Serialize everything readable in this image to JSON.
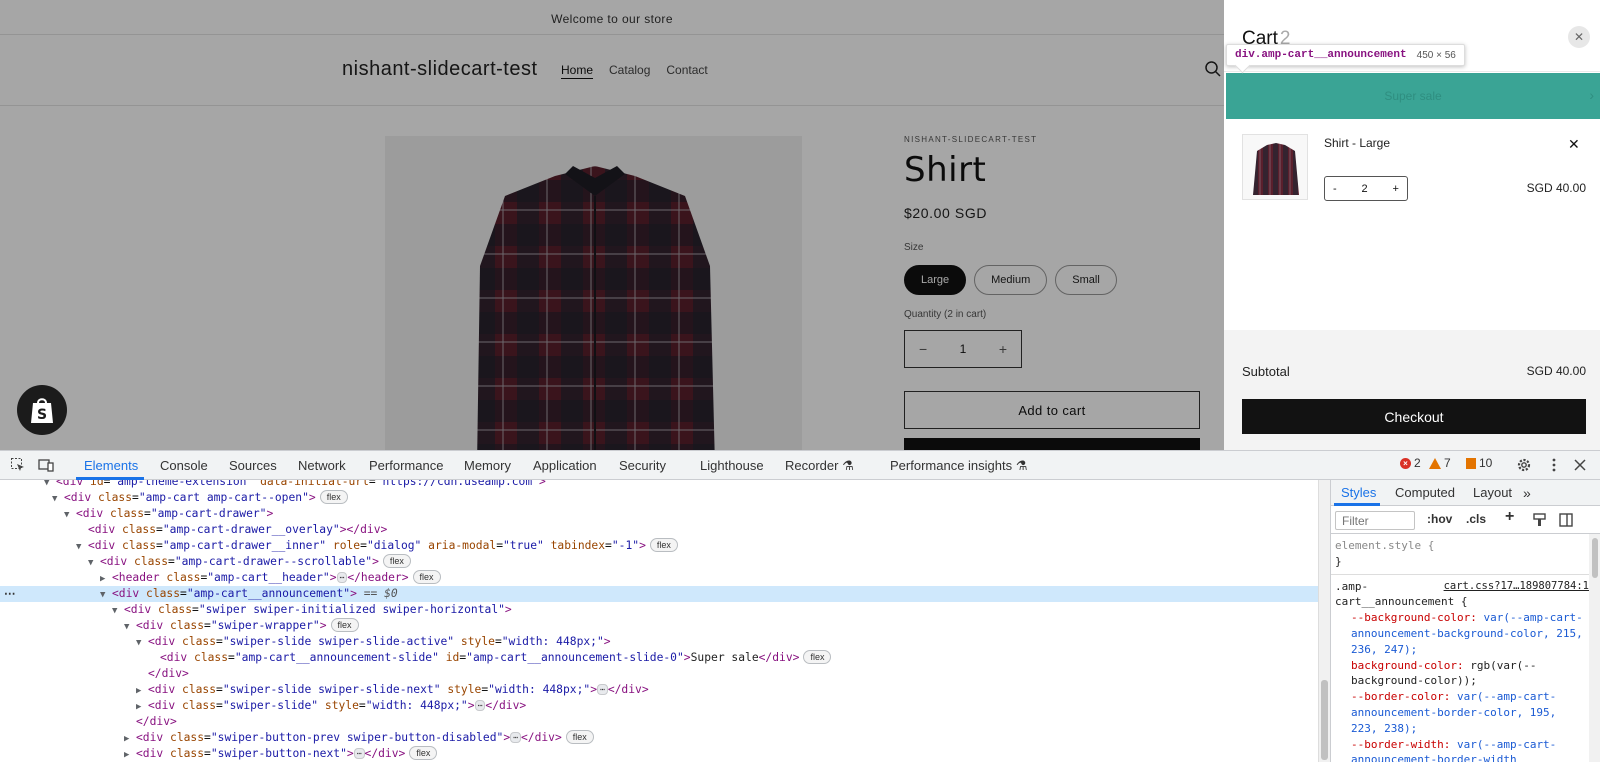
{
  "store": {
    "announcement": "Welcome to our store",
    "site_title": "nishant-slidecart-test",
    "nav": [
      "Home",
      "Catalog",
      "Contact"
    ],
    "vendor": "NISHANT-SLIDECART-TEST",
    "product_title": "Shirt",
    "price": "$20.00 SGD",
    "size_label": "Size",
    "sizes": [
      "Large",
      "Medium",
      "Small"
    ],
    "selected_size": "Large",
    "quantity_label": "Quantity (2 in cart)",
    "quantity": "1",
    "qty_minus": "−",
    "qty_plus": "+",
    "add_to_cart": "Add to cart"
  },
  "cart": {
    "title": "Cart",
    "count": "2",
    "close": "✕",
    "announcement": "Super sale",
    "announcement_next": "›",
    "item": {
      "name": "Shirt - Large",
      "remove": "✕",
      "minus": "-",
      "qty": "2",
      "plus": "+",
      "price": "SGD 40.00"
    },
    "subtotal_label": "Subtotal",
    "subtotal_value": "SGD 40.00",
    "checkout": "Checkout"
  },
  "inspect_tooltip": {
    "selector": "div.amp-cart__announcement",
    "dimensions": "450 × 56"
  },
  "devtools": {
    "tabs": [
      "Elements",
      "Console",
      "Sources",
      "Network",
      "Performance",
      "Memory",
      "Application",
      "Security",
      "Lighthouse",
      "Recorder",
      "Performance insights"
    ],
    "active_tab": "Elements",
    "errors": "2",
    "warnings": "7",
    "issues": "10",
    "dom": {
      "l0_tag": "<div",
      "l0_attr": "id",
      "l0_val": "\"amp-theme-extension\"",
      "l0_attr2": "data-initial-url",
      "l0_val2": "\"https://cdn.useamp.com\"",
      "l1": "\"amp-cart amp-cart--open\"",
      "l2": "\"amp-cart-drawer\"",
      "l3": "\"amp-cart-drawer__overlay\"",
      "l4": "\"amp-cart-drawer__inner\"",
      "l4_role": "\"dialog\"",
      "l4_modal": "\"true\"",
      "l4_tab": "\"-1\"",
      "l5": "\"amp-cart-drawer--scrollable\"",
      "l6": "\"amp-cart__header\"",
      "l7": "\"amp-cart__announcement\"",
      "l7_marker": "== $0",
      "l8": "\"swiper swiper-initialized swiper-horizontal\"",
      "l9": "\"swiper-wrapper\"",
      "l10": "\"swiper-slide swiper-slide-active\"",
      "l10_style": "\"width: 448px;\"",
      "l11": "\"amp-cart__announcement-slide\"",
      "l11_id": "\"amp-cart__announcement-slide-0\"",
      "l11_text": "Super sale",
      "l13": "\"swiper-slide swiper-slide-next\"",
      "l13_style": "\"width: 448px;\"",
      "l14": "\"swiper-slide\"",
      "l14_style": "\"width: 448px;\"",
      "l16": "\"swiper-button-prev swiper-button-disabled\"",
      "l17": "\"swiper-button-next\"",
      "flex": "flex"
    },
    "styles_tabs": [
      "Styles",
      "Computed",
      "Layout"
    ],
    "filter_placeholder": "Filter",
    "hov": ":hov",
    "cls": ".cls",
    "element_style": "element.style {",
    "close_brace": "}",
    "rule_selector_1": ".amp-",
    "rule_selector_2": "cart__announcement {",
    "rule_link": "cart.css?17…189807784:1",
    "props": [
      {
        "name": "--background-color",
        "value": "var(--amp-cart-announcement-background-color, 215, 236, 247);"
      },
      {
        "name": "background-color",
        "value": "rgb(var(--background-color));"
      },
      {
        "name": "--border-color",
        "value": "var(--amp-cart-announcement-border-color, 195, 223, 238);"
      },
      {
        "name": "--border-width",
        "value": "var(--amp-cart-announcement-border-width"
      }
    ]
  }
}
